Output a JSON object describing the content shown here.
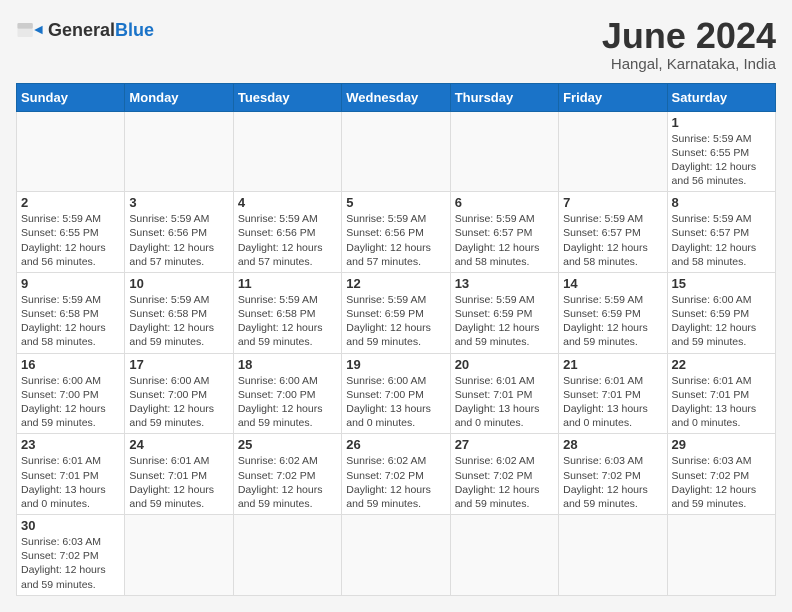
{
  "header": {
    "logo_general": "General",
    "logo_blue": "Blue",
    "title": "June 2024",
    "subtitle": "Hangal, Karnataka, India"
  },
  "weekdays": [
    "Sunday",
    "Monday",
    "Tuesday",
    "Wednesday",
    "Thursday",
    "Friday",
    "Saturday"
  ],
  "weeks": [
    [
      {
        "day": "",
        "info": ""
      },
      {
        "day": "",
        "info": ""
      },
      {
        "day": "",
        "info": ""
      },
      {
        "day": "",
        "info": ""
      },
      {
        "day": "",
        "info": ""
      },
      {
        "day": "",
        "info": ""
      },
      {
        "day": "1",
        "info": "Sunrise: 5:59 AM\nSunset: 6:55 PM\nDaylight: 12 hours\nand 56 minutes."
      }
    ],
    [
      {
        "day": "2",
        "info": "Sunrise: 5:59 AM\nSunset: 6:55 PM\nDaylight: 12 hours\nand 56 minutes."
      },
      {
        "day": "3",
        "info": "Sunrise: 5:59 AM\nSunset: 6:56 PM\nDaylight: 12 hours\nand 57 minutes."
      },
      {
        "day": "4",
        "info": "Sunrise: 5:59 AM\nSunset: 6:56 PM\nDaylight: 12 hours\nand 57 minutes."
      },
      {
        "day": "5",
        "info": "Sunrise: 5:59 AM\nSunset: 6:56 PM\nDaylight: 12 hours\nand 57 minutes."
      },
      {
        "day": "6",
        "info": "Sunrise: 5:59 AM\nSunset: 6:57 PM\nDaylight: 12 hours\nand 58 minutes."
      },
      {
        "day": "7",
        "info": "Sunrise: 5:59 AM\nSunset: 6:57 PM\nDaylight: 12 hours\nand 58 minutes."
      },
      {
        "day": "8",
        "info": "Sunrise: 5:59 AM\nSunset: 6:57 PM\nDaylight: 12 hours\nand 58 minutes."
      }
    ],
    [
      {
        "day": "9",
        "info": "Sunrise: 5:59 AM\nSunset: 6:58 PM\nDaylight: 12 hours\nand 58 minutes."
      },
      {
        "day": "10",
        "info": "Sunrise: 5:59 AM\nSunset: 6:58 PM\nDaylight: 12 hours\nand 59 minutes."
      },
      {
        "day": "11",
        "info": "Sunrise: 5:59 AM\nSunset: 6:58 PM\nDaylight: 12 hours\nand 59 minutes."
      },
      {
        "day": "12",
        "info": "Sunrise: 5:59 AM\nSunset: 6:59 PM\nDaylight: 12 hours\nand 59 minutes."
      },
      {
        "day": "13",
        "info": "Sunrise: 5:59 AM\nSunset: 6:59 PM\nDaylight: 12 hours\nand 59 minutes."
      },
      {
        "day": "14",
        "info": "Sunrise: 5:59 AM\nSunset: 6:59 PM\nDaylight: 12 hours\nand 59 minutes."
      },
      {
        "day": "15",
        "info": "Sunrise: 6:00 AM\nSunset: 6:59 PM\nDaylight: 12 hours\nand 59 minutes."
      }
    ],
    [
      {
        "day": "16",
        "info": "Sunrise: 6:00 AM\nSunset: 7:00 PM\nDaylight: 12 hours\nand 59 minutes."
      },
      {
        "day": "17",
        "info": "Sunrise: 6:00 AM\nSunset: 7:00 PM\nDaylight: 12 hours\nand 59 minutes."
      },
      {
        "day": "18",
        "info": "Sunrise: 6:00 AM\nSunset: 7:00 PM\nDaylight: 12 hours\nand 59 minutes."
      },
      {
        "day": "19",
        "info": "Sunrise: 6:00 AM\nSunset: 7:00 PM\nDaylight: 13 hours\nand 0 minutes."
      },
      {
        "day": "20",
        "info": "Sunrise: 6:01 AM\nSunset: 7:01 PM\nDaylight: 13 hours\nand 0 minutes."
      },
      {
        "day": "21",
        "info": "Sunrise: 6:01 AM\nSunset: 7:01 PM\nDaylight: 13 hours\nand 0 minutes."
      },
      {
        "day": "22",
        "info": "Sunrise: 6:01 AM\nSunset: 7:01 PM\nDaylight: 13 hours\nand 0 minutes."
      }
    ],
    [
      {
        "day": "23",
        "info": "Sunrise: 6:01 AM\nSunset: 7:01 PM\nDaylight: 13 hours\nand 0 minutes."
      },
      {
        "day": "24",
        "info": "Sunrise: 6:01 AM\nSunset: 7:01 PM\nDaylight: 12 hours\nand 59 minutes."
      },
      {
        "day": "25",
        "info": "Sunrise: 6:02 AM\nSunset: 7:02 PM\nDaylight: 12 hours\nand 59 minutes."
      },
      {
        "day": "26",
        "info": "Sunrise: 6:02 AM\nSunset: 7:02 PM\nDaylight: 12 hours\nand 59 minutes."
      },
      {
        "day": "27",
        "info": "Sunrise: 6:02 AM\nSunset: 7:02 PM\nDaylight: 12 hours\nand 59 minutes."
      },
      {
        "day": "28",
        "info": "Sunrise: 6:03 AM\nSunset: 7:02 PM\nDaylight: 12 hours\nand 59 minutes."
      },
      {
        "day": "29",
        "info": "Sunrise: 6:03 AM\nSunset: 7:02 PM\nDaylight: 12 hours\nand 59 minutes."
      }
    ],
    [
      {
        "day": "30",
        "info": "Sunrise: 6:03 AM\nSunset: 7:02 PM\nDaylight: 12 hours\nand 59 minutes."
      },
      {
        "day": "",
        "info": ""
      },
      {
        "day": "",
        "info": ""
      },
      {
        "day": "",
        "info": ""
      },
      {
        "day": "",
        "info": ""
      },
      {
        "day": "",
        "info": ""
      },
      {
        "day": "",
        "info": ""
      }
    ]
  ]
}
